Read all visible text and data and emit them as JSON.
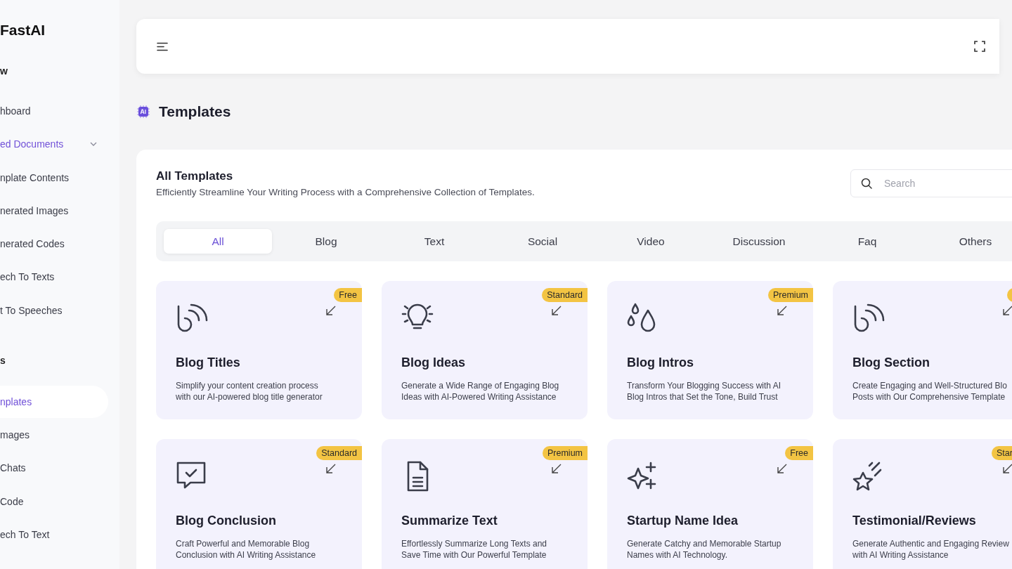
{
  "sidebar": {
    "logo": "FastAI",
    "groups": [
      {
        "heading": "w",
        "items": [
          {
            "label": "hboard",
            "kind": "link",
            "selected": false,
            "active": false
          },
          {
            "label": "ed Documents",
            "kind": "group",
            "selected": false,
            "active": true
          },
          {
            "label": "nplate Contents",
            "kind": "link",
            "selected": false,
            "active": false
          },
          {
            "label": "nerated Images",
            "kind": "link",
            "selected": false,
            "active": false
          },
          {
            "label": "nerated Codes",
            "kind": "link",
            "selected": false,
            "active": false
          },
          {
            "label": "ech To Texts",
            "kind": "link",
            "selected": false,
            "active": false
          },
          {
            "label": "t To Speeches",
            "kind": "link",
            "selected": false,
            "active": false
          }
        ]
      },
      {
        "heading": "s",
        "items": [
          {
            "label": "nplates",
            "kind": "link",
            "selected": true,
            "active": false
          },
          {
            "label": "mages",
            "kind": "link",
            "selected": false,
            "active": false
          },
          {
            "label": "Chats",
            "kind": "link",
            "selected": false,
            "active": false
          },
          {
            "label": "Code",
            "kind": "link",
            "selected": false,
            "active": false
          },
          {
            "label": "ech To Text",
            "kind": "link",
            "selected": false,
            "active": false
          }
        ]
      }
    ]
  },
  "page": {
    "title": "Templates"
  },
  "panel": {
    "title": "All Templates",
    "subtitle": "Efficiently Streamline Your Writing Process with a Comprehensive Collection of Templates.",
    "search": {
      "placeholder": "Search"
    },
    "tabs": [
      {
        "label": "All",
        "selected": true
      },
      {
        "label": "Blog",
        "selected": false
      },
      {
        "label": "Text",
        "selected": false
      },
      {
        "label": "Social",
        "selected": false
      },
      {
        "label": "Video",
        "selected": false
      },
      {
        "label": "Discussion",
        "selected": false
      },
      {
        "label": "Faq",
        "selected": false
      },
      {
        "label": "Others",
        "selected": false
      }
    ],
    "templates": [
      {
        "title": "Blog Titles",
        "description": "Simplify your content creation process\nwith our AI-powered blog title generator",
        "badge": "Free"
      },
      {
        "title": "Blog Ideas",
        "description": "Generate a Wide Range of Engaging Blog\nIdeas with AI-Powered Writing Assistance",
        "badge": "Standard"
      },
      {
        "title": "Blog Intros",
        "description": "Transform Your Blogging Success with AI\nBlog Intros that Set the Tone, Build Trust",
        "badge": "Premium"
      },
      {
        "title": "Blog Section",
        "description": "Create Engaging and Well-Structured Blo\nPosts with Our Comprehensive Template",
        "badge_partial": true
      },
      {
        "title": "Blog Conclusion",
        "description": "Craft Powerful and Memorable Blog\nConclusion with AI Writing Assistance",
        "badge": "Standard"
      },
      {
        "title": "Summarize Text",
        "description": "Effortlessly Summarize Long Texts and\nSave Time with Our Powerful Template",
        "badge": "Premium"
      },
      {
        "title": "Startup Name Idea",
        "description": "Generate Catchy and Memorable Startup\nNames with AI Technology.",
        "badge": "Free"
      },
      {
        "title": "Testimonial/Reviews",
        "description": "Generate Authentic and Engaging Review\nwith AI Writing Assistance",
        "badge": "Star",
        "badge_partial": true
      }
    ]
  }
}
